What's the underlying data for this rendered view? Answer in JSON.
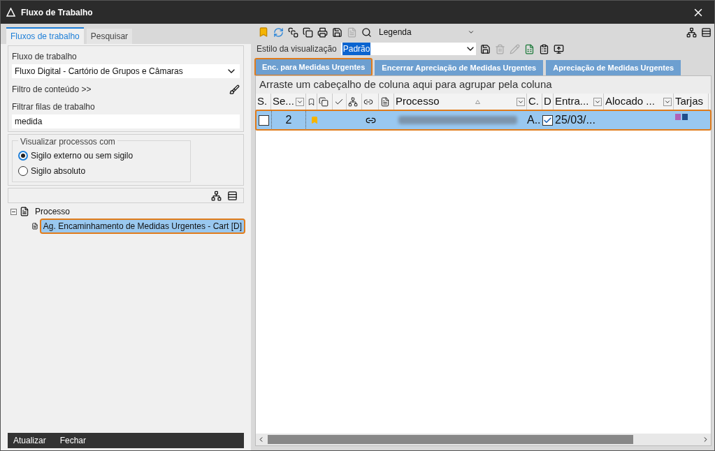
{
  "window": {
    "title": "Fluxo de Trabalho"
  },
  "left_tabs": [
    {
      "label": "Fluxos de trabalho",
      "selected": true
    },
    {
      "label": "Pesquisar",
      "selected": false
    }
  ],
  "workflow": {
    "label": "Fluxo de trabalho",
    "value": "Fluxo Digital - Cartório de Grupos e Câmaras"
  },
  "content_filter": "Filtro de conteúdo >>",
  "queue_filter": {
    "label": "Filtrar filas de trabalho",
    "value": "medida"
  },
  "visibility": {
    "legend": "Visualizar processos com",
    "options": [
      {
        "label": "Sigilo externo ou sem sigilo",
        "selected": true
      },
      {
        "label": "Sigilo absoluto",
        "selected": false
      }
    ]
  },
  "tree": {
    "label": "Processo",
    "expanded": true,
    "children": [
      {
        "label": "Ag. Encaminhamento de Medidas Urgentes - Cart [D]",
        "selected": true
      }
    ]
  },
  "footer_buttons": [
    "Atualizar",
    "Fechar"
  ],
  "toolbar": {
    "legend": "Legenda"
  },
  "view_style": {
    "label": "Estilo da visualização",
    "value": "Padrão"
  },
  "queue_tabs": [
    {
      "label": "Enc. para Medidas Urgentes",
      "selected": true
    },
    {
      "label": "Encerrar Apreciação de Medidas Urgentes",
      "selected": false
    },
    {
      "label": "Apreciação de Medidas Urgentes",
      "selected": false
    }
  ],
  "group_hint": "Arraste um cabeçalho de coluna aqui para agrupar pela coluna",
  "columns": [
    {
      "kind": "text",
      "label": "S."
    },
    {
      "kind": "text",
      "label": "Se...",
      "filter": true
    },
    {
      "kind": "icon"
    },
    {
      "kind": "icon"
    },
    {
      "kind": "icon"
    },
    {
      "kind": "icon"
    },
    {
      "kind": "icon"
    },
    {
      "kind": "icon"
    },
    {
      "kind": "text",
      "label": "Processo",
      "filter": true,
      "sorted": true
    },
    {
      "kind": "text",
      "label": "C."
    },
    {
      "kind": "text",
      "label": "D"
    },
    {
      "kind": "text",
      "label": "Entra...",
      "filter": true
    },
    {
      "kind": "text",
      "label": "Alocado ...",
      "filter": true
    },
    {
      "kind": "text",
      "label": "Tarjas"
    }
  ],
  "rows": [
    {
      "selected": true,
      "checked": false,
      "seq": "2",
      "bookmarked": true,
      "linked": true,
      "c": "A..",
      "d_checked": true,
      "entry": "25/03/...",
      "tags": [
        {
          "color": "#b061b8"
        },
        {
          "color": "#1f4e8c"
        }
      ]
    }
  ]
}
